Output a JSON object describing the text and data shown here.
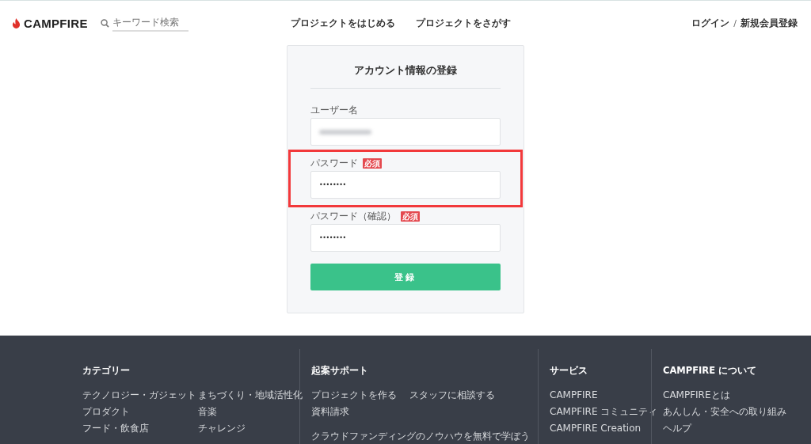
{
  "header": {
    "logo": "CAMPFIRE",
    "search": {
      "placeholder": "キーワード検索"
    },
    "nav": [
      "プロジェクトをはじめる",
      "プロジェクトをさがす"
    ],
    "login": "ログイン",
    "separator": "/",
    "signup": "新規会員登録"
  },
  "form": {
    "title": "アカウント情報の登録",
    "fields": [
      {
        "label": "ユーザー名",
        "required": false,
        "kind": "redacted",
        "highlighted": false
      },
      {
        "label": "パスワード",
        "required": true,
        "badge": "必須",
        "kind": "password",
        "value": "••••••••",
        "highlighted": true
      },
      {
        "label": "パスワード（確認）",
        "required": true,
        "badge": "必須",
        "kind": "password",
        "value": "••••••••",
        "highlighted": false
      }
    ],
    "submit": "登録"
  },
  "footer": {
    "columns": [
      {
        "title": "カテゴリー",
        "links": [
          "テクノロジー・ガジェット",
          "まちづくり・地域活性化",
          "プロダクト",
          "音楽",
          "フード・飲食店",
          "チャレンジ"
        ]
      },
      {
        "title": "起案サポート",
        "links": [
          "プロジェクトを作る",
          "スタッフに相談する",
          "資料請求"
        ],
        "note": "クラウドファンディングのノウハウを無料で学ぼう"
      },
      {
        "title": "サービス",
        "links": [
          "CAMPFIRE",
          "CAMPFIRE コミュニティ",
          "CAMPFIRE Creation"
        ]
      },
      {
        "title": "CAMPFIRE について",
        "links": [
          "CAMPFIREとは",
          "あんしん・安全への取り組み",
          "ヘルプ"
        ]
      }
    ]
  }
}
